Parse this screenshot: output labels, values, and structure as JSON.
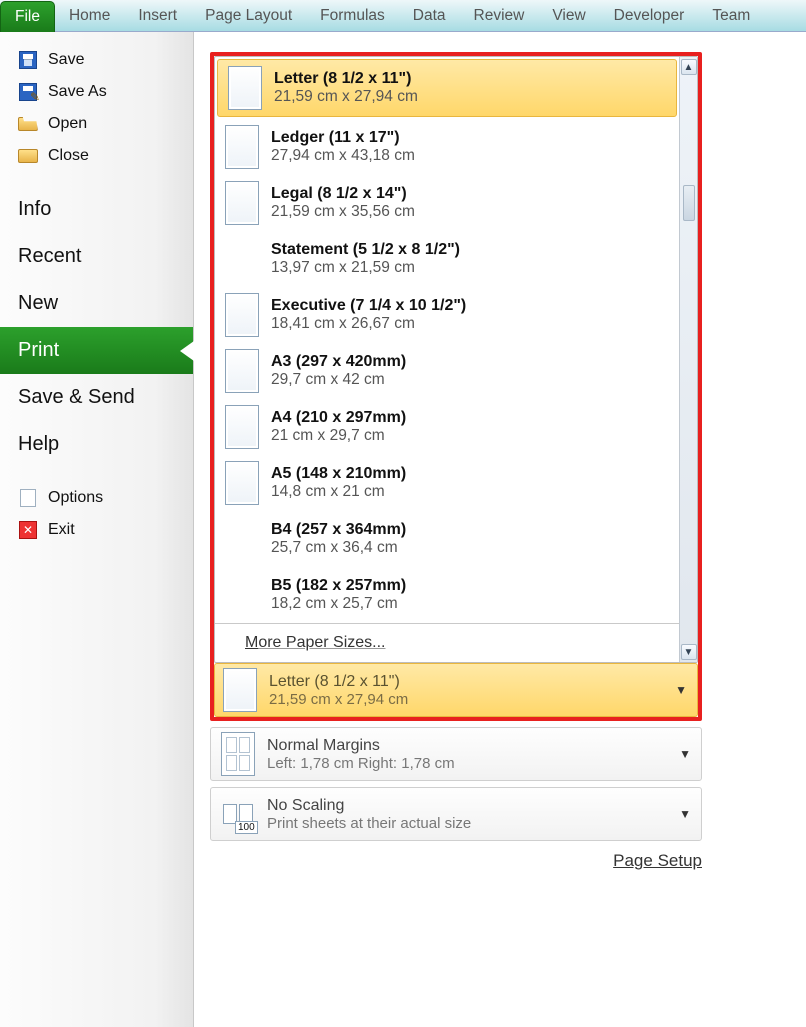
{
  "ribbon_tabs": [
    "File",
    "Home",
    "Insert",
    "Page Layout",
    "Formulas",
    "Data",
    "Review",
    "View",
    "Developer",
    "Team"
  ],
  "ribbon_active": "File",
  "sidebar": {
    "items_small_top": [
      {
        "label": "Save",
        "icon": "save-icon"
      },
      {
        "label": "Save As",
        "icon": "save-as-icon"
      },
      {
        "label": "Open",
        "icon": "folder-open-icon"
      },
      {
        "label": "Close",
        "icon": "folder-icon"
      }
    ],
    "items_big": [
      "Info",
      "Recent",
      "New",
      "Print",
      "Save & Send",
      "Help"
    ],
    "items_small_bottom": [
      {
        "label": "Options",
        "icon": "document-icon"
      },
      {
        "label": "Exit",
        "icon": "exit-icon"
      }
    ],
    "active": "Print"
  },
  "paper_sizes": [
    {
      "title": "Letter (8 1/2 x 11\")",
      "sub": "21,59 cm x 27,94 cm",
      "selected": true,
      "show_icon": true
    },
    {
      "title": "Ledger (11 x 17\")",
      "sub": "27,94 cm x 43,18 cm",
      "selected": false,
      "show_icon": true
    },
    {
      "title": "Legal (8 1/2 x 14\")",
      "sub": "21,59 cm x 35,56 cm",
      "selected": false,
      "show_icon": true
    },
    {
      "title": "Statement (5 1/2 x 8 1/2\")",
      "sub": "13,97 cm x 21,59 cm",
      "selected": false,
      "show_icon": false
    },
    {
      "title": "Executive (7 1/4 x 10 1/2\")",
      "sub": "18,41 cm x 26,67 cm",
      "selected": false,
      "show_icon": true
    },
    {
      "title": "A3 (297 x 420mm)",
      "sub": "29,7 cm x 42 cm",
      "selected": false,
      "show_icon": true
    },
    {
      "title": "A4 (210 x 297mm)",
      "sub": "21 cm x 29,7 cm",
      "selected": false,
      "show_icon": true
    },
    {
      "title": "A5 (148 x 210mm)",
      "sub": "14,8 cm x 21 cm",
      "selected": false,
      "show_icon": true
    },
    {
      "title": "B4 (257 x 364mm)",
      "sub": "25,7 cm x 36,4 cm",
      "selected": false,
      "show_icon": false
    },
    {
      "title": "B5 (182 x 257mm)",
      "sub": "18,2 cm x 25,7 cm",
      "selected": false,
      "show_icon": false
    }
  ],
  "more_sizes_label": "More Paper Sizes...",
  "current_paper": {
    "title": "Letter (8 1/2 x 11\")",
    "sub": "21,59 cm x 27,94 cm"
  },
  "margins_setting": {
    "title": "Normal Margins",
    "sub": "Left:  1,78 cm    Right:  1,78 cm"
  },
  "scaling_setting": {
    "title": "No Scaling",
    "sub": "Print sheets at their actual size",
    "badge": "100"
  },
  "page_setup_label": "Page Setup"
}
